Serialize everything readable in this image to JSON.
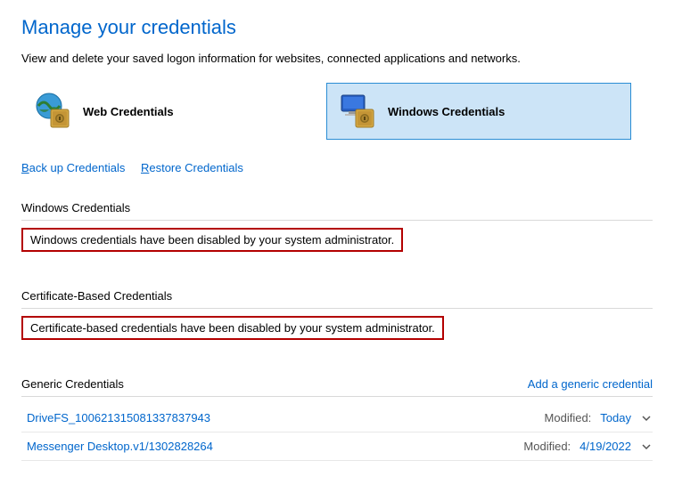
{
  "title": "Manage your credentials",
  "description": "View and delete your saved logon information for websites, connected applications and networks.",
  "tabs": {
    "web": "Web Credentials",
    "windows": "Windows Credentials"
  },
  "links": {
    "backup_prefix": "B",
    "backup_rest": "ack up Credentials",
    "restore_prefix": "R",
    "restore_rest": "estore Credentials"
  },
  "sections": {
    "windows": {
      "header": "Windows Credentials",
      "notice": "Windows credentials have been disabled by your system administrator."
    },
    "cert": {
      "header": "Certificate-Based Credentials",
      "notice": "Certificate-based credentials have been disabled by your system administrator."
    },
    "generic": {
      "header": "Generic Credentials",
      "add_label": "Add a generic credential",
      "modified_label": "Modified:",
      "items": [
        {
          "name": "DriveFS_100621315081337837943",
          "date": "Today"
        },
        {
          "name": "Messenger Desktop.v1/1302828264",
          "date": "4/19/2022"
        }
      ]
    }
  }
}
